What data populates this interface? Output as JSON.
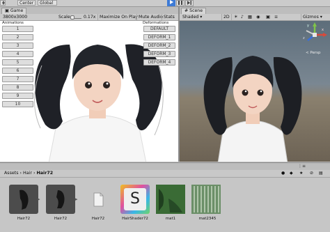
{
  "toolbar": {
    "pivot_label": "Center",
    "space_label": "Global",
    "play_icon": "play-icon",
    "pause_icon": "pause-icon",
    "step_icon": "step-icon"
  },
  "game": {
    "tab_label": "Game",
    "resolution": "3800x3000",
    "scale_label": "Scale",
    "scale_value": "0.17x",
    "maximize_label": "Maximize On Play",
    "mute_label": "Mute Audio",
    "stats_label": "Stats",
    "animations_label": "Animations",
    "deformations_label": "Deformations",
    "animation_buttons": [
      "1",
      "2",
      "3",
      "4",
      "5",
      "6",
      "7",
      "8",
      "9",
      "10"
    ],
    "deform_buttons": [
      "DEFAULT",
      "DEFORM_1",
      "DEFORM_2",
      "DEFORM_3",
      "DEFORM_4"
    ]
  },
  "scene": {
    "tab_label": "Scene",
    "shading_mode": "Shaded",
    "mode_2d": "2D",
    "gizmos_label": "Gizmos",
    "persp_label": "< Persp",
    "axis_labels": [
      "y",
      "x",
      "z"
    ]
  },
  "project": {
    "breadcrumb": [
      "Assets",
      "Hair",
      "Hair72"
    ],
    "assets": [
      {
        "name": "Hair72",
        "kind": "model"
      },
      {
        "name": "Hair72",
        "kind": "model"
      },
      {
        "name": "Hair72",
        "kind": "file"
      },
      {
        "name": "HairShader72",
        "kind": "shader"
      },
      {
        "name": "mat1",
        "kind": "material"
      },
      {
        "name": "mat2345",
        "kind": "material"
      }
    ],
    "shader_glyph": "S"
  },
  "colors": {
    "accent_play": "#3e7bd6",
    "panel_bg": "#c2c2c2",
    "scene_sky": "#6b7a86",
    "shader_gradient": [
      "#f0c020",
      "#e04fa0",
      "#38b6e8",
      "#6fd36a"
    ]
  }
}
